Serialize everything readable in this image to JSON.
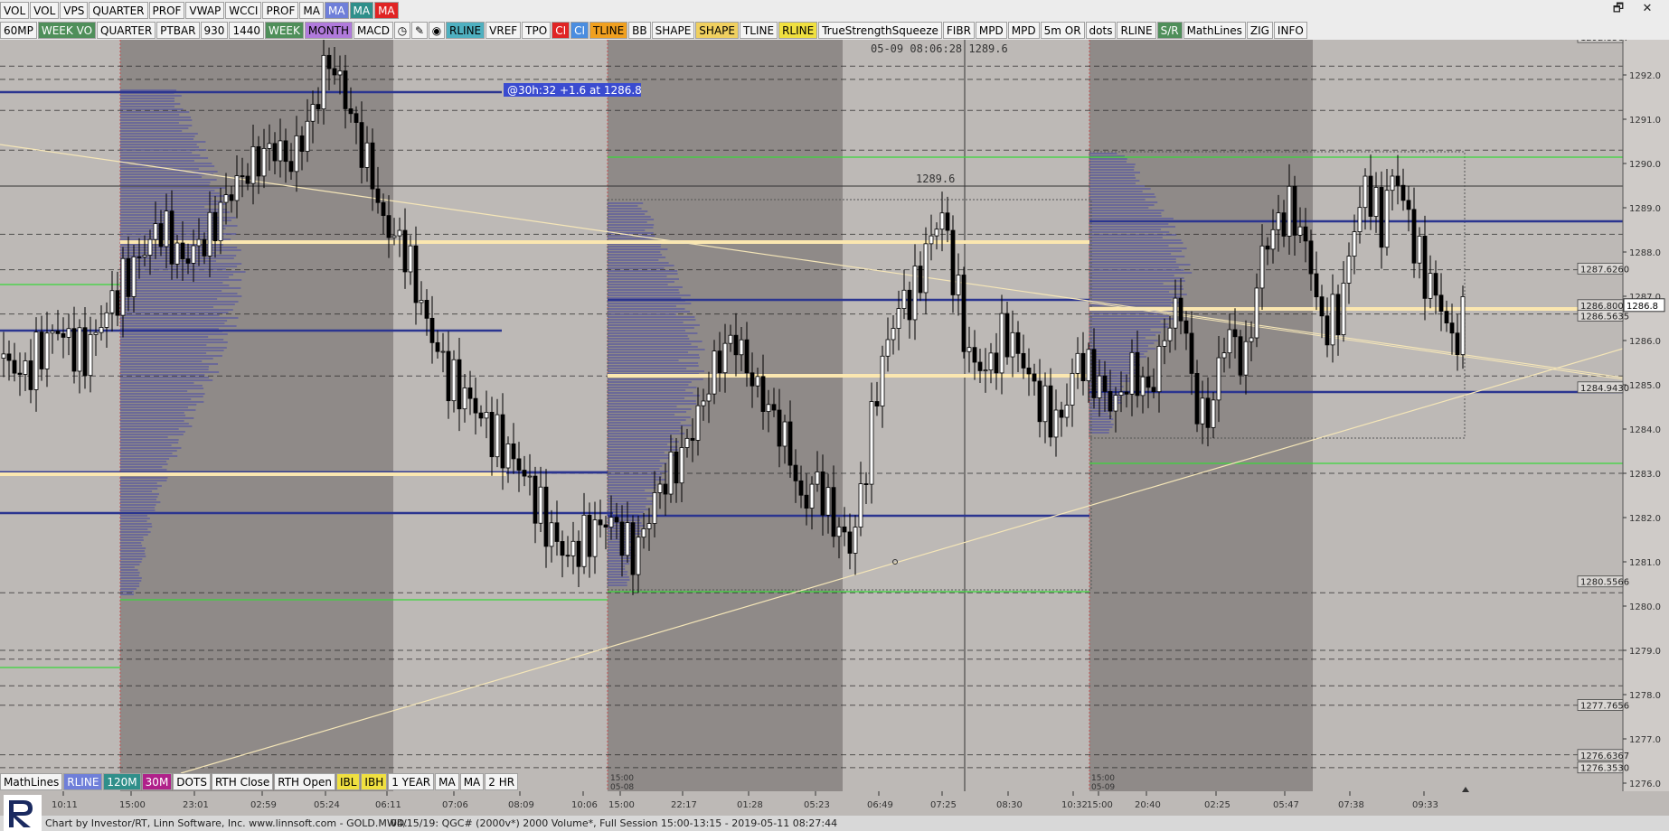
{
  "toolbar_row1": [
    {
      "label": "VOL",
      "bg": "#f4f4f4"
    },
    {
      "label": "VOL",
      "bg": "#f4f4f4"
    },
    {
      "label": "VPS",
      "bg": "#f4f4f4"
    },
    {
      "label": "QUARTER",
      "bg": "#f4f4f4"
    },
    {
      "label": "PROF",
      "bg": "#f4f4f4"
    },
    {
      "label": "VWAP",
      "bg": "#f4f4f4"
    },
    {
      "label": "WCCI",
      "bg": "#f4f4f4"
    },
    {
      "label": "PROF",
      "bg": "#f4f4f4"
    },
    {
      "label": "MA",
      "bg": "#f4f4f4"
    },
    {
      "label": "MA",
      "bg": "#6f7fd9"
    },
    {
      "label": "MA",
      "bg": "#2f8f8a"
    },
    {
      "label": "MA",
      "bg": "#e02424"
    }
  ],
  "toolbar_row2": [
    {
      "label": "60MP",
      "bg": "#f4f4f4"
    },
    {
      "label": "WEEK VO",
      "bg": "#4f8f5a"
    },
    {
      "label": "QUARTER",
      "bg": "#f4f4f4"
    },
    {
      "label": "PTBAR",
      "bg": "#f4f4f4"
    },
    {
      "label": "930",
      "bg": "#f4f4f4"
    },
    {
      "label": "1440",
      "bg": "#f4f4f4"
    },
    {
      "label": "WEEK",
      "bg": "#4f8f5a"
    },
    {
      "label": "MONTH",
      "bg": "#b07adb"
    },
    {
      "label": "MACD",
      "bg": "#f4f4f4"
    },
    {
      "label": "◷",
      "bg": "#f4f4f4",
      "icon": "clock-icon"
    },
    {
      "label": "✎",
      "bg": "#f4f4f4",
      "icon": "pencil-icon"
    },
    {
      "label": "◉",
      "bg": "#f4f4f4",
      "icon": "target-icon"
    },
    {
      "label": "RLINE",
      "bg": "#4fb0c0"
    },
    {
      "label": "VREF",
      "bg": "#f4f4f4"
    },
    {
      "label": "TPO",
      "bg": "#f4f4f4"
    },
    {
      "label": "CI",
      "bg": "#e02424"
    },
    {
      "label": "CI",
      "bg": "#4a8de0"
    },
    {
      "label": "TLINE",
      "bg": "#f0a020"
    },
    {
      "label": "BB",
      "bg": "#f4f4f4"
    },
    {
      "label": "SHAPE",
      "bg": "#f4f4f4"
    },
    {
      "label": "SHAPE",
      "bg": "#f0d060"
    },
    {
      "label": "TLINE",
      "bg": "#f4f4f4"
    },
    {
      "label": "RLINE",
      "bg": "#f0e040"
    },
    {
      "label": "TrueStrengthSqueeze",
      "bg": "#f4f4f4"
    },
    {
      "label": "FIBR",
      "bg": "#f4f4f4"
    },
    {
      "label": "MPD",
      "bg": "#f4f4f4"
    },
    {
      "label": "MPD",
      "bg": "#f4f4f4"
    },
    {
      "label": "5m OR",
      "bg": "#f4f4f4"
    },
    {
      "label": "dots",
      "bg": "#f4f4f4"
    },
    {
      "label": "RLINE",
      "bg": "#f4f4f4"
    },
    {
      "label": "S/R",
      "bg": "#4f8f5a"
    },
    {
      "label": "MathLines",
      "bg": "#f4f4f4"
    },
    {
      "label": "ZIG",
      "bg": "#f4f4f4"
    },
    {
      "label": "INFO",
      "bg": "#f4f4f4"
    }
  ],
  "toolbar_row3": [
    {
      "label": "MathLines",
      "bg": "#f4f4f4"
    },
    {
      "label": "RLINE",
      "bg": "#6f7fd9"
    },
    {
      "label": "120M",
      "bg": "#2f8f8a"
    },
    {
      "label": "30M",
      "bg": "#b0208a"
    },
    {
      "label": "DOTS",
      "bg": "#f4f4f4"
    },
    {
      "label": "RTH Close",
      "bg": "#f4f4f4"
    },
    {
      "label": "RTH Open",
      "bg": "#f4f4f4"
    },
    {
      "label": "IBL",
      "bg": "#f0e040"
    },
    {
      "label": "IBH",
      "bg": "#f0e040"
    },
    {
      "label": "1 YEAR",
      "bg": "#f4f4f4"
    },
    {
      "label": "MA",
      "bg": "#f4f4f4"
    },
    {
      "label": "MA",
      "bg": "#f4f4f4"
    },
    {
      "label": "2 HR",
      "bg": "#f4f4f4"
    }
  ],
  "window_controls": {
    "restore": "🗗",
    "close": "✕"
  },
  "crosshair_readout": "05-09 08:06:28  1289.6",
  "crosshair_price_label": "1289.6",
  "annotation": "@30h:32  +1.6 at 1286.8",
  "price_axis": {
    "ticks": [
      "1292.0",
      "1291.0",
      "1290.0",
      "1289.0",
      "1288.0",
      "1287.0",
      "1286.0",
      "1285.0",
      "1284.0",
      "1283.0",
      "1282.0",
      "1281.0",
      "1280.0",
      "1279.0",
      "1278.0",
      "1277.0",
      "1276.0"
    ],
    "boxed_labels": [
      "1292.8567",
      "1287.6260",
      "1286.8000",
      "1286.5635",
      "1284.9430",
      "1280.5566",
      "1277.7656",
      "1276.6367",
      "1276.3530"
    ],
    "current_price": "1286.8"
  },
  "time_axis": {
    "ticks": [
      "10:11",
      "15:00",
      "23:01",
      "02:59",
      "05:24",
      "06:11",
      "07:06",
      "08:09",
      "10:06",
      "15:00",
      "22:17",
      "01:28",
      "05:23",
      "06:49",
      "07:25",
      "08:30",
      "10:32",
      "15:00",
      "20:40",
      "02:25",
      "05:47",
      "07:38",
      "09:33"
    ],
    "session_labels": [
      {
        "time": "15:00",
        "date": "05-08"
      },
      {
        "time": "15:00",
        "date": "05-09"
      }
    ]
  },
  "status": {
    "left": "Chart by Investor/RT, Linn Software, Inc. www.linnsoft.com - GOLD.MWD.",
    "mid": "04/15/19: QGC# (2000v*) 2000 Volume*, Full Session 15:00-13:15 - 2019-05-11 08:27:44"
  },
  "colors": {
    "bg_light": "#bdb9b6",
    "bg_dark": "#8f8a88",
    "bg_mid": "#a7a3a1",
    "profile": "#5a5aa0",
    "navy": "#2b3590",
    "cream": "#fbe7b0",
    "green": "#39d839",
    "candle_up": "#ffffff",
    "candle_down": "#000000"
  }
}
